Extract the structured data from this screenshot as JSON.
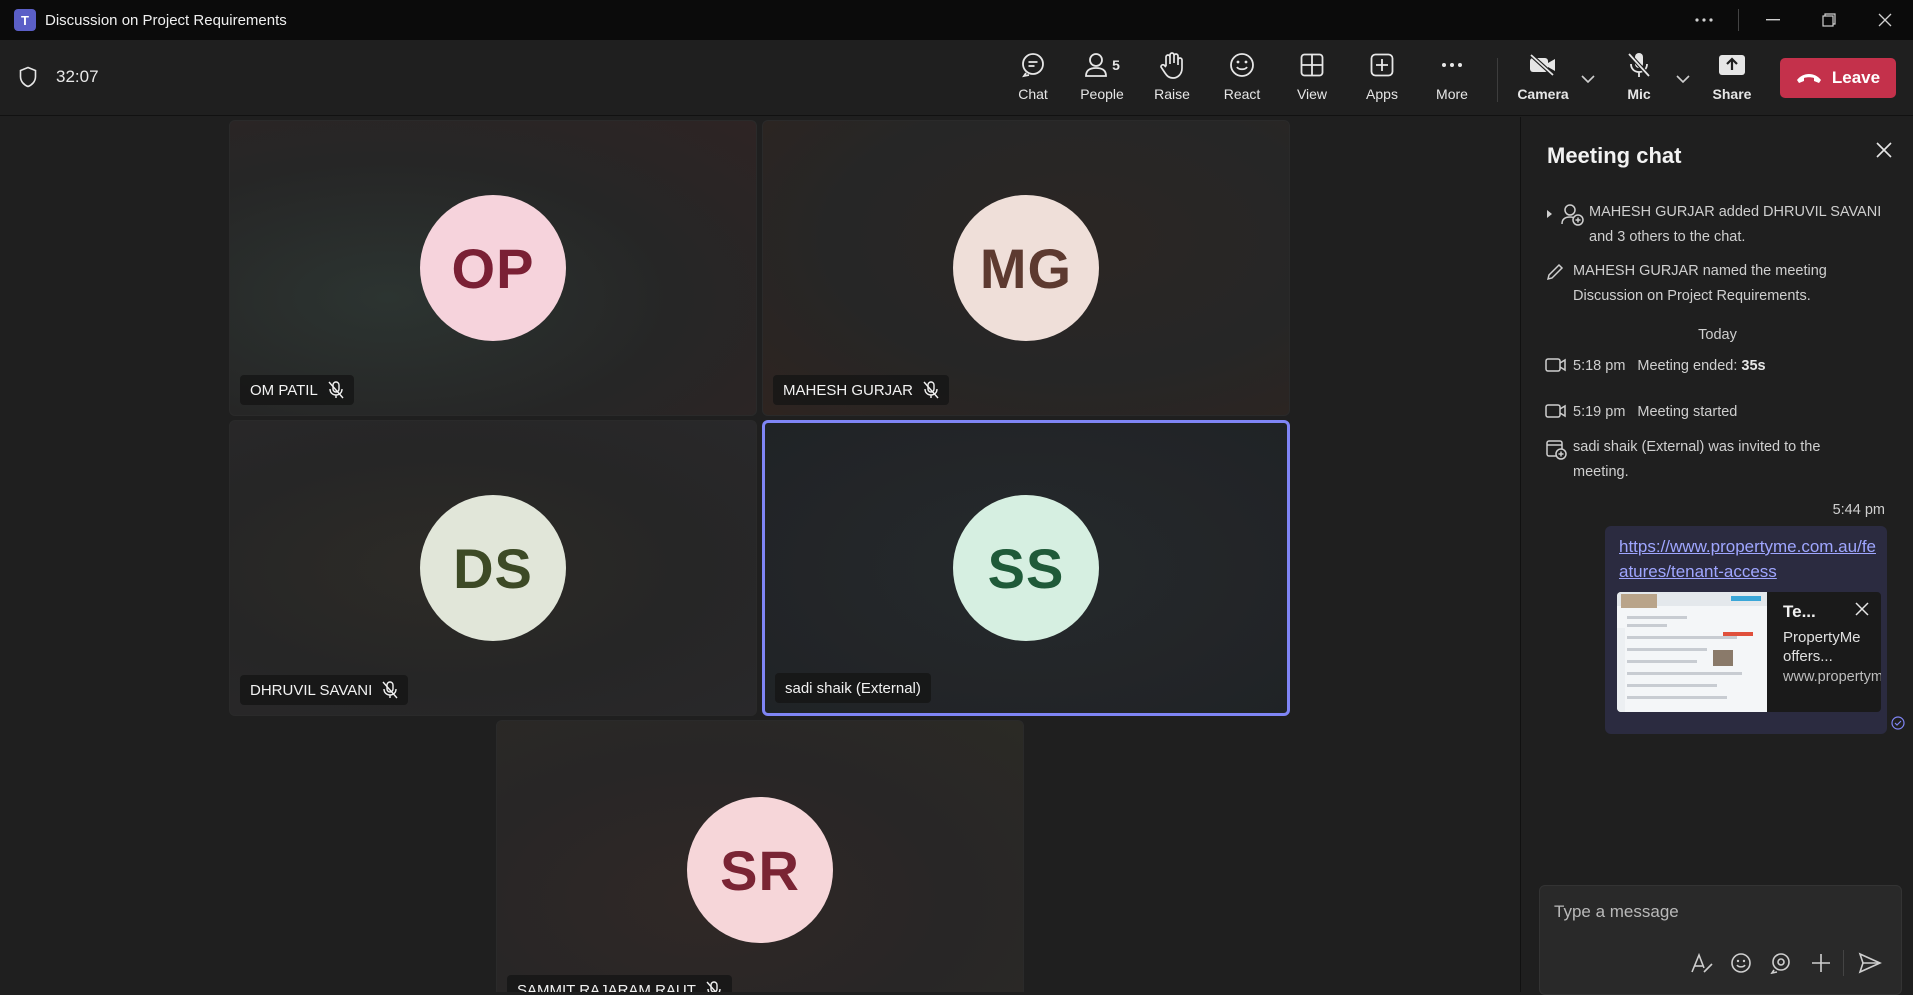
{
  "window": {
    "title": "Discussion on Project Requirements",
    "app_icon": "T"
  },
  "toolbar": {
    "timer": "32:07",
    "buttons": {
      "chat": "Chat",
      "people": "People",
      "people_count": "5",
      "raise": "Raise",
      "react": "React",
      "view": "View",
      "apps": "Apps",
      "more": "More",
      "camera": "Camera",
      "mic": "Mic",
      "share": "Share"
    },
    "leave": "Leave",
    "colors": {
      "leave": "#c4314b",
      "accent": "#7f85f5"
    }
  },
  "participants": [
    {
      "initials": "OP",
      "name": "OM PATIL",
      "muted": true,
      "avatar_bg": "#f6d3dc",
      "avatar_fg": "#7a2035"
    },
    {
      "initials": "MG",
      "name": "MAHESH GURJAR",
      "muted": true,
      "avatar_bg": "#efdfd9",
      "avatar_fg": "#5d3a30"
    },
    {
      "initials": "DS",
      "name": "DHRUVIL SAVANI",
      "muted": true,
      "avatar_bg": "#e1e6d9",
      "avatar_fg": "#3d4a26"
    },
    {
      "initials": "SS",
      "name": "sadi shaik (External)",
      "muted": false,
      "avatar_bg": "#d6efe1",
      "avatar_fg": "#1f5a39"
    },
    {
      "initials": "SR",
      "name": "SAMMIT RAJARAM RAUT",
      "muted": true,
      "avatar_bg": "#f6d6d9",
      "avatar_fg": "#7a2434"
    }
  ],
  "chat": {
    "title": "Meeting chat",
    "events": [
      {
        "text": "MAHESH GURJAR added DHRUVIL SAVANI and 3 others to the chat."
      },
      {
        "text": "MAHESH GURJAR named the meeting Discussion on Project Requirements."
      }
    ],
    "day_divider": "Today",
    "meeting_events": [
      {
        "time": "5:18 pm",
        "text": "Meeting ended: ",
        "bold": "35s"
      },
      {
        "time": "5:19 pm",
        "text": "Meeting started"
      }
    ],
    "invite": "sadi shaik (External) was invited to the meeting.",
    "message": {
      "time": "5:44 pm",
      "link": "https://www.propertyme.com.au/features/tenant-access",
      "preview_title": "Te...",
      "preview_desc": "PropertyMe offers...",
      "preview_url": "www.propertyme.c..."
    },
    "compose_placeholder": "Type a message"
  }
}
